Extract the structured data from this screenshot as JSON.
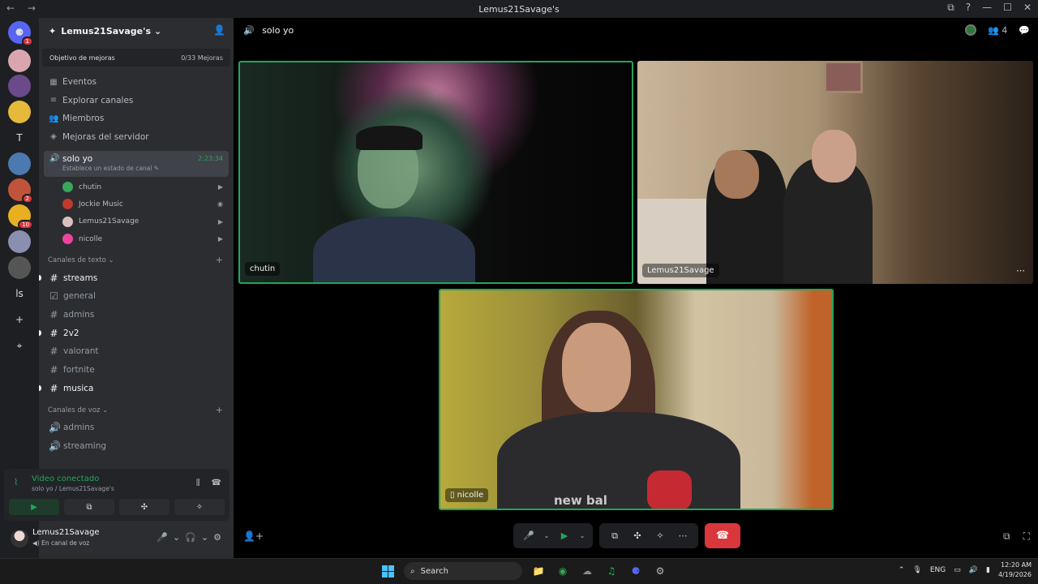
{
  "window": {
    "title": "Lemus21Savage's",
    "nav_glyphs": "← →",
    "controls": [
      "⧉",
      "?",
      "—",
      "☐",
      "✕"
    ]
  },
  "server_rail": {
    "items": [
      {
        "glyph": "⚈",
        "badge": "1",
        "color": "#5865f2"
      },
      {
        "glyph": "",
        "badge": "",
        "color": "#d9a6b0"
      },
      {
        "glyph": "",
        "badge": "",
        "color": "#6a4a8a"
      },
      {
        "glyph": "",
        "badge": "",
        "color": "#e5b93a"
      },
      {
        "glyph": "T",
        "badge": "",
        "color": "#1e1f22"
      },
      {
        "glyph": "",
        "badge": "",
        "color": "#4a7ab0"
      },
      {
        "glyph": "",
        "badge": "2",
        "color": "#c0543a"
      },
      {
        "glyph": "",
        "badge": "10",
        "color": "#e8b020"
      },
      {
        "glyph": "",
        "badge": "",
        "color": "#8a8fb0"
      },
      {
        "glyph": "",
        "badge": "",
        "color": "#555"
      },
      {
        "glyph": "ls",
        "badge": "",
        "color": "#1e1f22"
      },
      {
        "glyph": "+",
        "badge": "",
        "color": "#1e1f22"
      },
      {
        "glyph": "⌖",
        "badge": "",
        "color": "#1e1f22"
      }
    ]
  },
  "sidebar": {
    "server_name": "Lemus21Savage's",
    "server_chevron": "⌄",
    "boost": {
      "label": "Objetivo de mejoras",
      "progress": "0/33 Mejoras"
    },
    "nav_items": [
      {
        "icon": "▦",
        "label": "Eventos"
      },
      {
        "icon": "≡",
        "label": "Explorar canales"
      },
      {
        "icon": "👥",
        "label": "Miembros"
      },
      {
        "icon": "◈",
        "label": "Mejoras del servidor"
      }
    ],
    "active_voice": {
      "name": "solo yo",
      "time": "2:23:34",
      "status": "Establece un estado de canal ✎",
      "users": [
        {
          "name": "chutin",
          "avatar_color": "#3ba55c",
          "indicator": "▶"
        },
        {
          "name": "Jockie Music",
          "avatar_color": "#c0392b",
          "indicator": "◉"
        },
        {
          "name": "Lemus21Savage",
          "avatar_color": "#d8c0c0",
          "indicator": "▶"
        },
        {
          "name": "nicolle",
          "avatar_color": "#eb459e",
          "indicator": "▶"
        }
      ]
    },
    "text_category": "Canales de texto ⌄",
    "text_channels": [
      {
        "name": "streams",
        "unread": true,
        "icon": "#"
      },
      {
        "name": "general",
        "unread": false,
        "icon": "☑"
      },
      {
        "name": "admins",
        "unread": false,
        "icon": "#"
      },
      {
        "name": "2v2",
        "unread": true,
        "icon": "#"
      },
      {
        "name": "valorant",
        "unread": false,
        "icon": "#"
      },
      {
        "name": "fortnite",
        "unread": false,
        "icon": "#"
      },
      {
        "name": "musica",
        "unread": true,
        "icon": "#"
      }
    ],
    "voice_category": "Canales de voz ⌄",
    "voice_channels": [
      {
        "name": "admins",
        "icon": "🔊"
      },
      {
        "name": "streaming",
        "icon": "🔊"
      }
    ]
  },
  "voice_panel": {
    "connected": "Video conectado",
    "sub": "solo yo / Lemus21Savage's",
    "buttons": [
      "▶",
      "⧉",
      "✣",
      "✧"
    ]
  },
  "user_panel": {
    "name": "Lemus21Savage",
    "status": "◀) En canal de voz",
    "controls": [
      "🎤",
      "⌄",
      "🎧",
      "⌄",
      "⚙"
    ]
  },
  "main": {
    "channel_title": "solo yo",
    "participant_count": "4",
    "tiles": [
      {
        "name": "chutin",
        "speaking": true
      },
      {
        "name": "Lemus21Savage",
        "speaking": false
      },
      {
        "name": "▯ nicolle",
        "speaking": true
      }
    ],
    "shirt_text": "new bal"
  },
  "call_dock": {
    "left": [
      "🎤",
      "⌄",
      "▶",
      "⌄"
    ],
    "right": [
      "⧉",
      "✣",
      "✧",
      "⋯"
    ],
    "hangup": "☎"
  },
  "taskbar": {
    "search_label": "Search",
    "language": "ENG",
    "time": "12:20 AM",
    "date": "4/19/2026",
    "apps": [
      {
        "glyph": "📁",
        "color": "#e8b93a"
      },
      {
        "glyph": "◉",
        "color": "#34a853"
      },
      {
        "glyph": "☁",
        "color": "#888"
      },
      {
        "glyph": "♫",
        "color": "#1db954"
      },
      {
        "glyph": "⚈",
        "color": "#5865f2"
      },
      {
        "glyph": "⚙",
        "color": "#b5bac1"
      }
    ]
  },
  "colors": {
    "accent": "#23a55a",
    "danger": "#da373c",
    "brand": "#5865f2"
  }
}
